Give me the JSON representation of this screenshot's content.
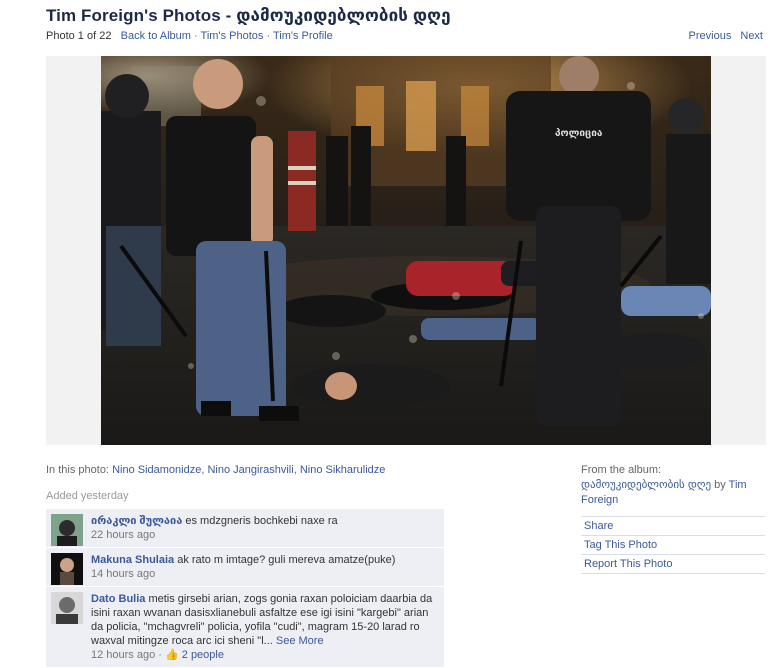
{
  "header": {
    "title": "Tim Foreign's Photos - დამოუკიდებლობის დღე",
    "photo_count": "Photo 1 of 22",
    "back_link": "Back to Album",
    "photos_link": "Tim's Photos",
    "profile_link": "Tim's Profile",
    "separator": "·",
    "previous": "Previous",
    "next": "Next"
  },
  "tags": {
    "label": "In this photo:",
    "people": [
      "Nino Sidamonidze",
      "Nino Jangirashvili",
      "Nino Sikharulidze"
    ]
  },
  "added": "Added yesterday",
  "comments": [
    {
      "author": "ირაკლი შულაია",
      "text": "es mdzgneris bochkebi naxe ra",
      "time": "22 hours ago"
    },
    {
      "author": "Makuna Shulaia",
      "text": "ak rato m imtage? guli mereva amatze(puke)",
      "time": "14 hours ago"
    },
    {
      "author": "Dato Bulia",
      "text": "metis girsebi arian, zogs gonia raxan poloiciam daarbia da isini raxan wvanan dasisxlianebuli asfaltze ese igi isini \"kargebi\" arian da policia, \"mchagvreli\" policia, yofila \"cudi\", magram 15-20 larad ro waxval mitingze roca arc ici sheni \"l...",
      "see_more": "See More",
      "time": "12 hours ago",
      "likes": "2 people"
    }
  ],
  "album": {
    "label": "From the album:",
    "name": "დამოუკიდებლობის დღე",
    "by": "by",
    "owner": "Tim Foreign"
  },
  "actions": [
    "Share",
    "Tag This Photo",
    "Report This Photo"
  ],
  "photo": {
    "jacket_text": "პოლიცია"
  }
}
